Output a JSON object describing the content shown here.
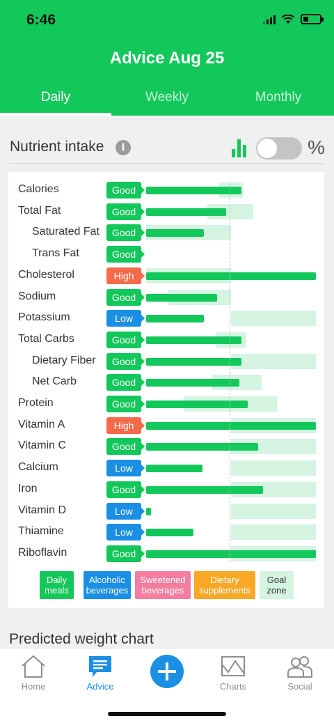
{
  "status_bar": {
    "time": "6:46"
  },
  "header": {
    "title": "Advice Aug 25"
  },
  "tabs": [
    {
      "label": "Daily",
      "active": true
    },
    {
      "label": "Weekly",
      "active": false
    },
    {
      "label": "Monthly",
      "active": false
    }
  ],
  "section": {
    "title": "Nutrient intake",
    "info_icon": "i",
    "percent_label": "%",
    "toggle_on": false
  },
  "nutrients": [
    {
      "name": "Calories",
      "indent": false,
      "status": "Good",
      "level": "good",
      "intake": 0.56,
      "goal": [
        0.43,
        0.57
      ]
    },
    {
      "name": "Total Fat",
      "indent": false,
      "status": "Good",
      "level": "good",
      "intake": 0.47,
      "goal": [
        0.36,
        0.63
      ]
    },
    {
      "name": "Saturated Fat",
      "indent": true,
      "status": "Good",
      "level": "good",
      "intake": 0.34,
      "goal": [
        0.0,
        0.5
      ]
    },
    {
      "name": "Trans Fat",
      "indent": true,
      "status": "Good",
      "level": "good",
      "intake": 0.0,
      "goal": [
        0.0,
        0.0
      ]
    },
    {
      "name": "Cholesterol",
      "indent": false,
      "status": "High",
      "level": "high",
      "intake": 1.0,
      "goal": [
        0.0,
        0.5
      ]
    },
    {
      "name": "Sodium",
      "indent": false,
      "status": "Good",
      "level": "good",
      "intake": 0.42,
      "goal": [
        0.13,
        0.5
      ]
    },
    {
      "name": "Potassium",
      "indent": false,
      "status": "Low",
      "level": "low",
      "intake": 0.34,
      "goal": [
        0.5,
        1.0
      ]
    },
    {
      "name": "Total Carbs",
      "indent": false,
      "status": "Good",
      "level": "good",
      "intake": 0.56,
      "goal": [
        0.41,
        0.59
      ]
    },
    {
      "name": "Dietary Fiber",
      "indent": true,
      "status": "Good",
      "level": "good",
      "intake": 0.56,
      "goal": [
        0.5,
        1.0
      ]
    },
    {
      "name": "Net Carb",
      "indent": true,
      "status": "Good",
      "level": "good",
      "intake": 0.55,
      "goal": [
        0.39,
        0.68
      ]
    },
    {
      "name": "Protein",
      "indent": false,
      "status": "Good",
      "level": "good",
      "intake": 0.6,
      "goal": [
        0.22,
        0.77
      ]
    },
    {
      "name": "Vitamin A",
      "indent": false,
      "status": "High",
      "level": "high",
      "intake": 1.0,
      "goal": [
        0.5,
        1.0
      ]
    },
    {
      "name": "Vitamin C",
      "indent": false,
      "status": "Good",
      "level": "good",
      "intake": 0.66,
      "goal": [
        0.5,
        1.0
      ]
    },
    {
      "name": "Calcium",
      "indent": false,
      "status": "Low",
      "level": "low",
      "intake": 0.33,
      "goal": [
        0.5,
        1.0
      ]
    },
    {
      "name": "Iron",
      "indent": false,
      "status": "Good",
      "level": "good",
      "intake": 0.69,
      "goal": [
        0.5,
        1.0
      ]
    },
    {
      "name": "Vitamin D",
      "indent": false,
      "status": "Low",
      "level": "low",
      "intake": 0.03,
      "goal": [
        0.5,
        1.0
      ]
    },
    {
      "name": "Thiamine",
      "indent": false,
      "status": "Low",
      "level": "low",
      "intake": 0.28,
      "goal": [
        0.5,
        1.0
      ]
    },
    {
      "name": "Riboflavin",
      "indent": false,
      "status": "Good",
      "level": "good",
      "intake": 1.0,
      "goal": [
        0.5,
        1.0
      ]
    }
  ],
  "legend": [
    {
      "label": "Daily meals",
      "color": "#13c85a",
      "text_color": "#ffffff"
    },
    {
      "label": "Alcoholic beverages",
      "color": "#1a8fe3",
      "text_color": "#ffffff"
    },
    {
      "label": "Sweetened beverages",
      "color": "#f47da0",
      "text_color": "#ffffff"
    },
    {
      "label": "Dietary supplements",
      "color": "#f9a825",
      "text_color": "#ffffff"
    },
    {
      "label": "Goal zone",
      "color": "#d5f4e1",
      "text_color": "#333333"
    }
  ],
  "weight_chart": {
    "title": "Predicted weight chart"
  },
  "bottom_nav": [
    {
      "label": "Home",
      "icon": "home-icon",
      "active": false
    },
    {
      "label": "Advice",
      "icon": "advice-icon",
      "active": true
    },
    {
      "label": "",
      "icon": "plus-icon",
      "active": false
    },
    {
      "label": "Charts",
      "icon": "charts-icon",
      "active": false
    },
    {
      "label": "Social",
      "icon": "social-icon",
      "active": false
    }
  ],
  "colors": {
    "brand_green": "#13c85a",
    "high": "#f46a4b",
    "low": "#1a8fe3",
    "goal_zone": "#d5f4e1"
  }
}
